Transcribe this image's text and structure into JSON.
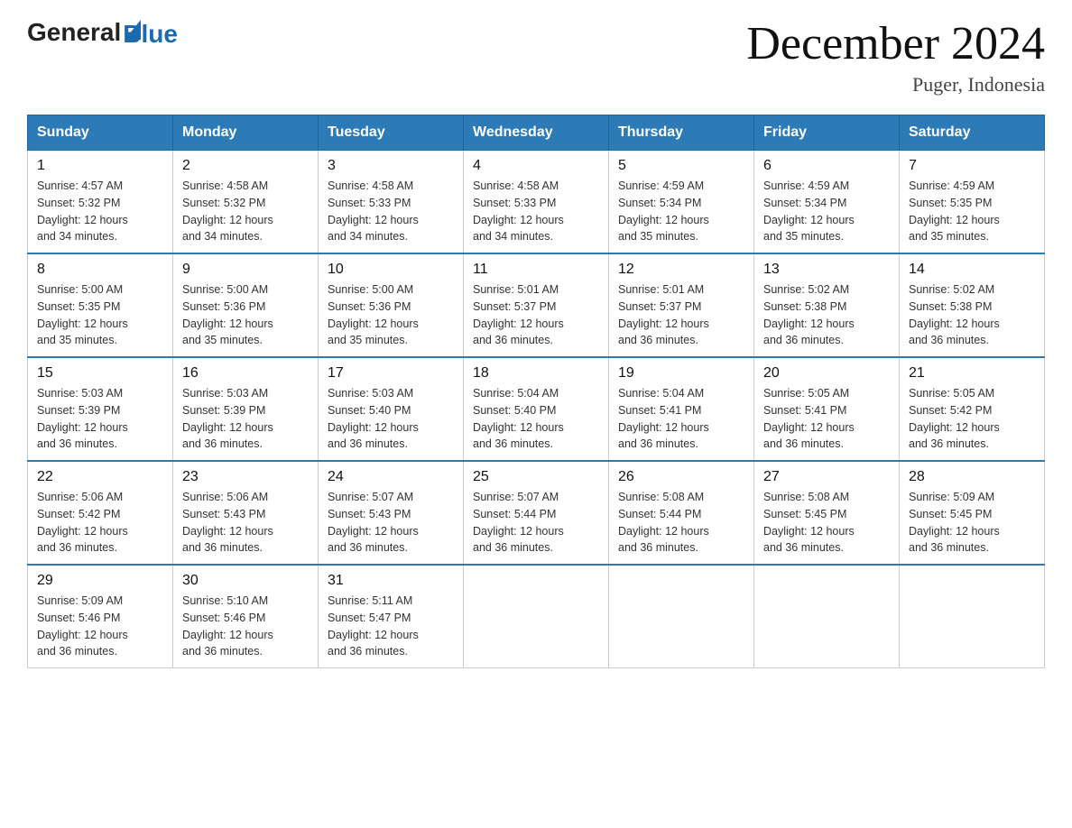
{
  "header": {
    "logo_general": "General",
    "logo_blue": "Blue",
    "month_title": "December 2024",
    "location": "Puger, Indonesia"
  },
  "weekdays": [
    "Sunday",
    "Monday",
    "Tuesday",
    "Wednesday",
    "Thursday",
    "Friday",
    "Saturday"
  ],
  "weeks": [
    [
      {
        "day": "1",
        "sunrise": "4:57 AM",
        "sunset": "5:32 PM",
        "daylight": "12 hours and 34 minutes."
      },
      {
        "day": "2",
        "sunrise": "4:58 AM",
        "sunset": "5:32 PM",
        "daylight": "12 hours and 34 minutes."
      },
      {
        "day": "3",
        "sunrise": "4:58 AM",
        "sunset": "5:33 PM",
        "daylight": "12 hours and 34 minutes."
      },
      {
        "day": "4",
        "sunrise": "4:58 AM",
        "sunset": "5:33 PM",
        "daylight": "12 hours and 34 minutes."
      },
      {
        "day": "5",
        "sunrise": "4:59 AM",
        "sunset": "5:34 PM",
        "daylight": "12 hours and 35 minutes."
      },
      {
        "day": "6",
        "sunrise": "4:59 AM",
        "sunset": "5:34 PM",
        "daylight": "12 hours and 35 minutes."
      },
      {
        "day": "7",
        "sunrise": "4:59 AM",
        "sunset": "5:35 PM",
        "daylight": "12 hours and 35 minutes."
      }
    ],
    [
      {
        "day": "8",
        "sunrise": "5:00 AM",
        "sunset": "5:35 PM",
        "daylight": "12 hours and 35 minutes."
      },
      {
        "day": "9",
        "sunrise": "5:00 AM",
        "sunset": "5:36 PM",
        "daylight": "12 hours and 35 minutes."
      },
      {
        "day": "10",
        "sunrise": "5:00 AM",
        "sunset": "5:36 PM",
        "daylight": "12 hours and 35 minutes."
      },
      {
        "day": "11",
        "sunrise": "5:01 AM",
        "sunset": "5:37 PM",
        "daylight": "12 hours and 36 minutes."
      },
      {
        "day": "12",
        "sunrise": "5:01 AM",
        "sunset": "5:37 PM",
        "daylight": "12 hours and 36 minutes."
      },
      {
        "day": "13",
        "sunrise": "5:02 AM",
        "sunset": "5:38 PM",
        "daylight": "12 hours and 36 minutes."
      },
      {
        "day": "14",
        "sunrise": "5:02 AM",
        "sunset": "5:38 PM",
        "daylight": "12 hours and 36 minutes."
      }
    ],
    [
      {
        "day": "15",
        "sunrise": "5:03 AM",
        "sunset": "5:39 PM",
        "daylight": "12 hours and 36 minutes."
      },
      {
        "day": "16",
        "sunrise": "5:03 AM",
        "sunset": "5:39 PM",
        "daylight": "12 hours and 36 minutes."
      },
      {
        "day": "17",
        "sunrise": "5:03 AM",
        "sunset": "5:40 PM",
        "daylight": "12 hours and 36 minutes."
      },
      {
        "day": "18",
        "sunrise": "5:04 AM",
        "sunset": "5:40 PM",
        "daylight": "12 hours and 36 minutes."
      },
      {
        "day": "19",
        "sunrise": "5:04 AM",
        "sunset": "5:41 PM",
        "daylight": "12 hours and 36 minutes."
      },
      {
        "day": "20",
        "sunrise": "5:05 AM",
        "sunset": "5:41 PM",
        "daylight": "12 hours and 36 minutes."
      },
      {
        "day": "21",
        "sunrise": "5:05 AM",
        "sunset": "5:42 PM",
        "daylight": "12 hours and 36 minutes."
      }
    ],
    [
      {
        "day": "22",
        "sunrise": "5:06 AM",
        "sunset": "5:42 PM",
        "daylight": "12 hours and 36 minutes."
      },
      {
        "day": "23",
        "sunrise": "5:06 AM",
        "sunset": "5:43 PM",
        "daylight": "12 hours and 36 minutes."
      },
      {
        "day": "24",
        "sunrise": "5:07 AM",
        "sunset": "5:43 PM",
        "daylight": "12 hours and 36 minutes."
      },
      {
        "day": "25",
        "sunrise": "5:07 AM",
        "sunset": "5:44 PM",
        "daylight": "12 hours and 36 minutes."
      },
      {
        "day": "26",
        "sunrise": "5:08 AM",
        "sunset": "5:44 PM",
        "daylight": "12 hours and 36 minutes."
      },
      {
        "day": "27",
        "sunrise": "5:08 AM",
        "sunset": "5:45 PM",
        "daylight": "12 hours and 36 minutes."
      },
      {
        "day": "28",
        "sunrise": "5:09 AM",
        "sunset": "5:45 PM",
        "daylight": "12 hours and 36 minutes."
      }
    ],
    [
      {
        "day": "29",
        "sunrise": "5:09 AM",
        "sunset": "5:46 PM",
        "daylight": "12 hours and 36 minutes."
      },
      {
        "day": "30",
        "sunrise": "5:10 AM",
        "sunset": "5:46 PM",
        "daylight": "12 hours and 36 minutes."
      },
      {
        "day": "31",
        "sunrise": "5:11 AM",
        "sunset": "5:47 PM",
        "daylight": "12 hours and 36 minutes."
      },
      null,
      null,
      null,
      null
    ]
  ],
  "labels": {
    "sunrise_prefix": "Sunrise: ",
    "sunset_prefix": "Sunset: ",
    "daylight_prefix": "Daylight: "
  }
}
